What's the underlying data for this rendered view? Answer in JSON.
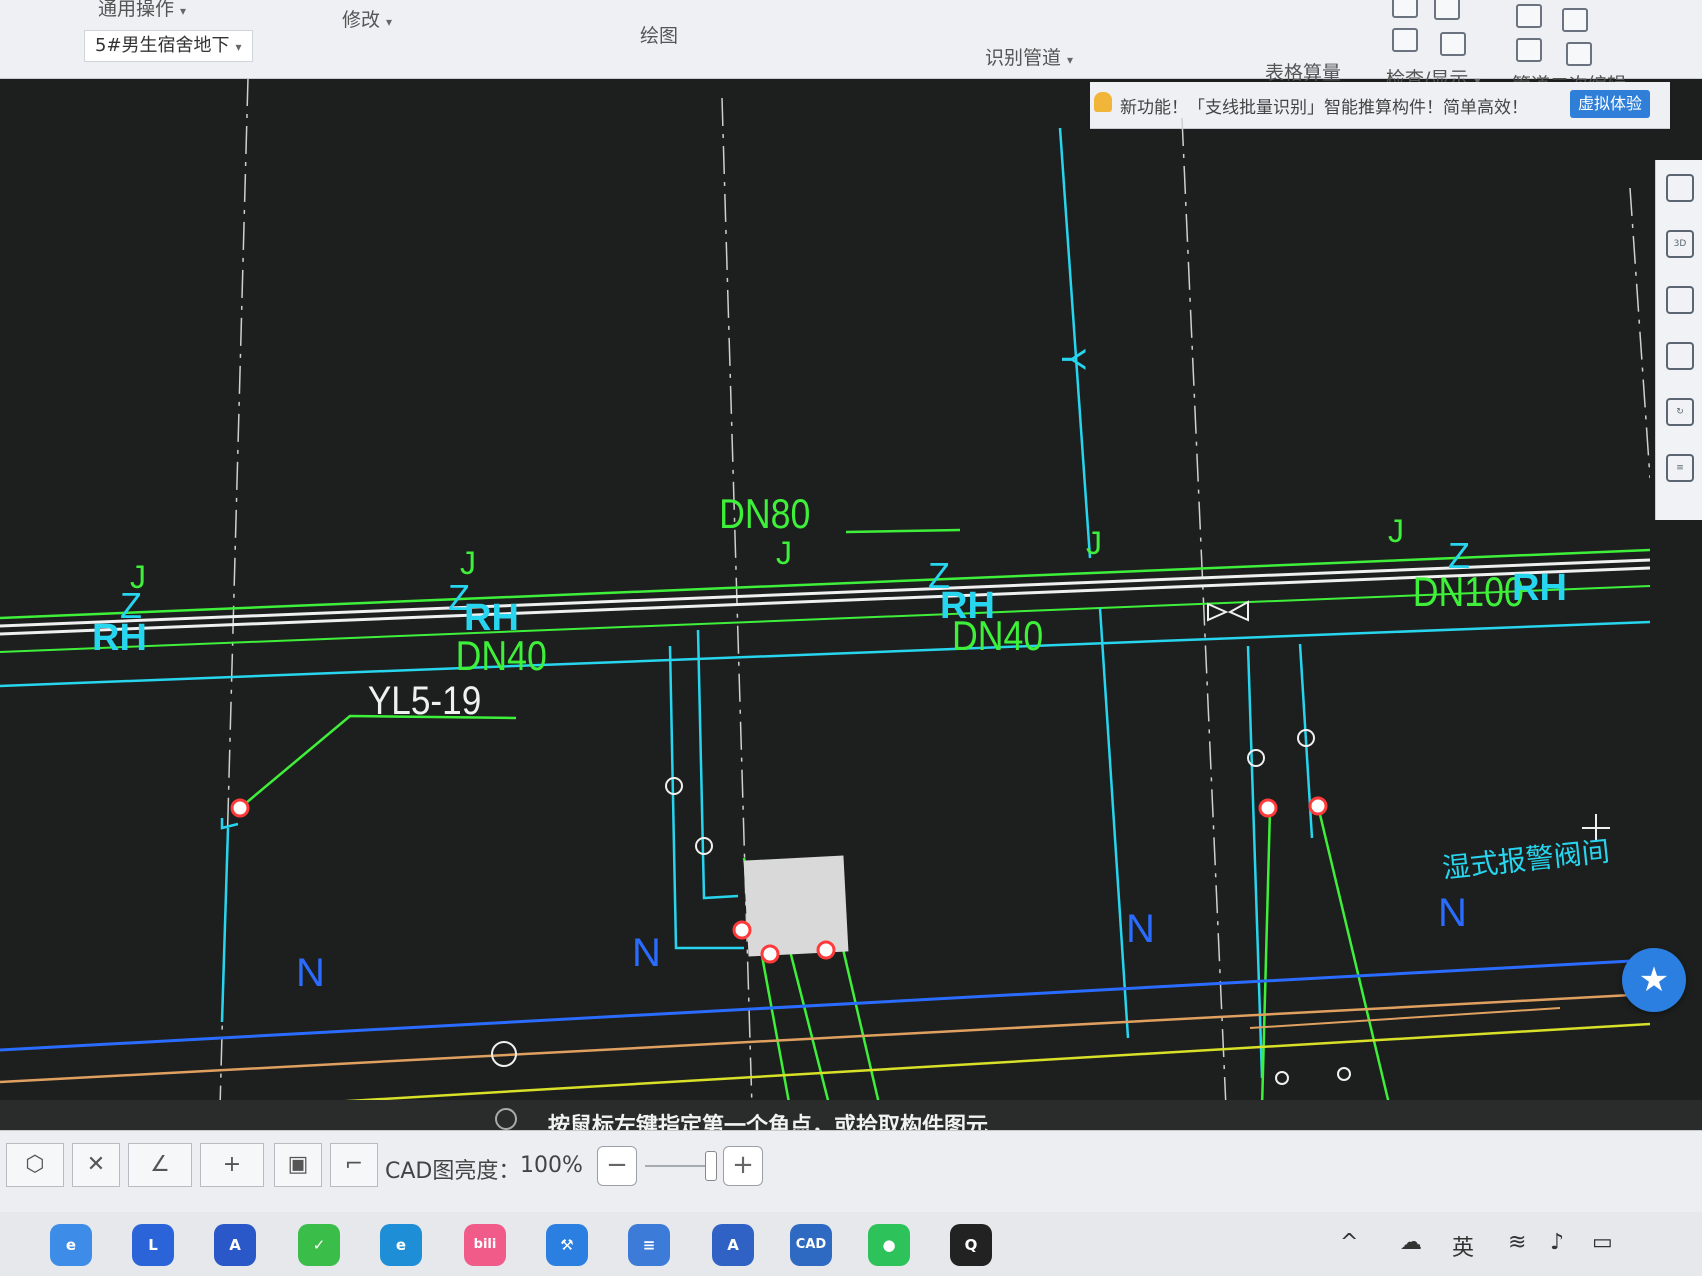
{
  "ribbon": {
    "groups": [
      {
        "label": "通用操作",
        "caret": "▾"
      },
      {
        "label": "修改",
        "caret": "▾"
      },
      {
        "label": "绘图",
        "caret": ""
      },
      {
        "label": "识别管道",
        "caret": "▾"
      },
      {
        "label": "表格算量",
        "caret": ""
      },
      {
        "label": "检查/显示",
        "caret": "▾"
      },
      {
        "label": "管道二次编辑",
        "caret": "▾"
      }
    ],
    "floor_select": "5#男生宿舍地下",
    "floor_caret": "▾"
  },
  "notice": {
    "text": "新功能！「支线批量识别」智能推算构件！简单高效！",
    "button": "虚拟体验"
  },
  "drawing": {
    "labels": {
      "dn80": "DN80",
      "dn40_a": "DN40",
      "dn40_b": "DN40",
      "dn100": "DN100",
      "yl": "YL5-19",
      "rh": "RH",
      "z": "Z",
      "j": "J",
      "n": "N",
      "y": "Y",
      "valve_note": "湿式报警阀间"
    },
    "colors": {
      "green": "#3ef03a",
      "cyan": "#27d5ee",
      "blue": "#2a6cff",
      "orange": "#e0a060",
      "yellow": "#d8e028",
      "white": "#f0f0f0",
      "red": "#ff3a3a"
    }
  },
  "side_toolbar": [
    {
      "icon": "sphere-icon",
      "text": ""
    },
    {
      "icon": "3d-view-icon",
      "text": "3D"
    },
    {
      "icon": "cube-icon",
      "text": ""
    },
    {
      "icon": "box-icon",
      "text": ""
    },
    {
      "icon": "rotate-icon",
      "text": "↻"
    },
    {
      "icon": "list-icon",
      "text": "≡"
    }
  ],
  "prompt": {
    "text": "按鼠标左键指定第一个角点，或拾取构件图元"
  },
  "tool_strip": {
    "brightness_label": "CAD图亮度：",
    "brightness_value": "100%",
    "zoom_out": "−",
    "zoom_in": "+"
  },
  "taskbar": {
    "apps": [
      {
        "name": "ai-browser-icon",
        "label": "e",
        "color": "#3c8ce8"
      },
      {
        "name": "l-app-icon",
        "label": "L",
        "color": "#2b64d9"
      },
      {
        "name": "a-app-icon",
        "label": "A",
        "color": "#2a58c8"
      },
      {
        "name": "wallet-icon",
        "label": "✓",
        "color": "#3bbd4a"
      },
      {
        "name": "edge-icon",
        "label": "e",
        "color": "#1e8fd6"
      },
      {
        "name": "bilibili-icon",
        "label": "bili",
        "color": "#f15b8a"
      },
      {
        "name": "tool-app-icon",
        "label": "⚒",
        "color": "#2a7fe0"
      },
      {
        "name": "doc-app-icon",
        "label": "≡",
        "color": "#3c7cd8"
      },
      {
        "name": "glodon-icon",
        "label": "A",
        "color": "#3062c6"
      },
      {
        "name": "cad-icon",
        "label": "CAD",
        "color": "#2f6ac2"
      },
      {
        "name": "wechat-icon",
        "label": "●",
        "color": "#2dc35a"
      },
      {
        "name": "qq-icon",
        "label": "Q",
        "color": "#222222"
      }
    ],
    "tray": {
      "chevron": "^",
      "ime": "英"
    }
  }
}
